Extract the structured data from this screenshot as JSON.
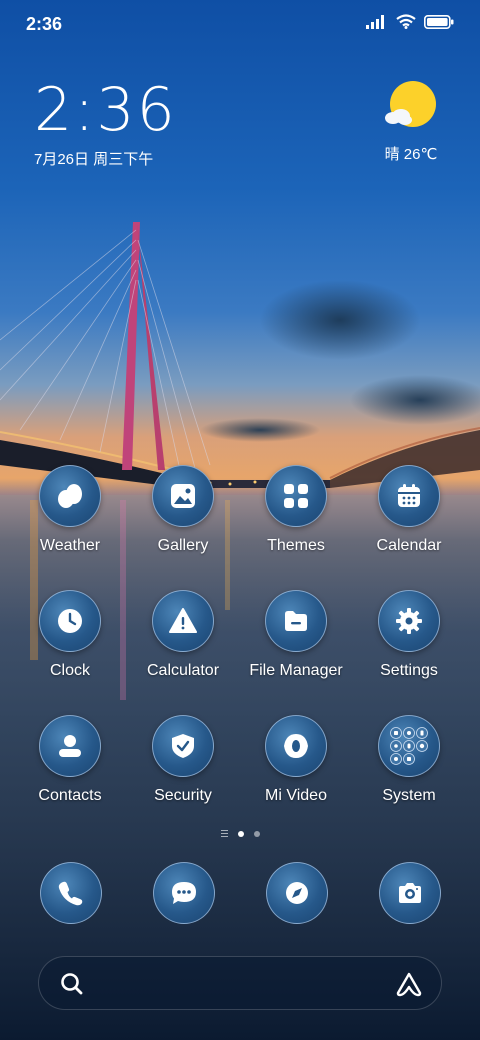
{
  "status_bar": {
    "time": "2:36",
    "icons": [
      "signal-icon",
      "wifi-icon",
      "battery-icon"
    ]
  },
  "clock_widget": {
    "time": "2:36",
    "date": "7月26日 周三下午"
  },
  "weather_widget": {
    "icon": "sun-cloud-icon",
    "text": "晴 26℃"
  },
  "apps": [
    {
      "label": "Weather",
      "icon": "weather-icon"
    },
    {
      "label": "Gallery",
      "icon": "gallery-icon"
    },
    {
      "label": "Themes",
      "icon": "themes-icon"
    },
    {
      "label": "Calendar",
      "icon": "calendar-icon"
    },
    {
      "label": "Clock",
      "icon": "clock-icon"
    },
    {
      "label": "Calculator",
      "icon": "calculator-icon"
    },
    {
      "label": "File Manager",
      "icon": "folder-icon"
    },
    {
      "label": "Settings",
      "icon": "gear-icon"
    },
    {
      "label": "Contacts",
      "icon": "contacts-icon"
    },
    {
      "label": "Security",
      "icon": "shield-icon"
    },
    {
      "label": "Mi Video",
      "icon": "video-icon"
    },
    {
      "label": "System",
      "icon": "folder-grid-icon"
    }
  ],
  "pager": {
    "pages": 2,
    "active": 1
  },
  "dock": [
    {
      "icon": "phone-icon"
    },
    {
      "icon": "messages-icon"
    },
    {
      "icon": "browser-icon"
    },
    {
      "icon": "camera-icon"
    }
  ],
  "search": {
    "icon": "search-icon",
    "assistant_icon": "assistant-icon"
  },
  "colors": {
    "icon_fill": "#26588a",
    "icon_border": "#d2e6ff",
    "sun": "#fcd12a"
  }
}
